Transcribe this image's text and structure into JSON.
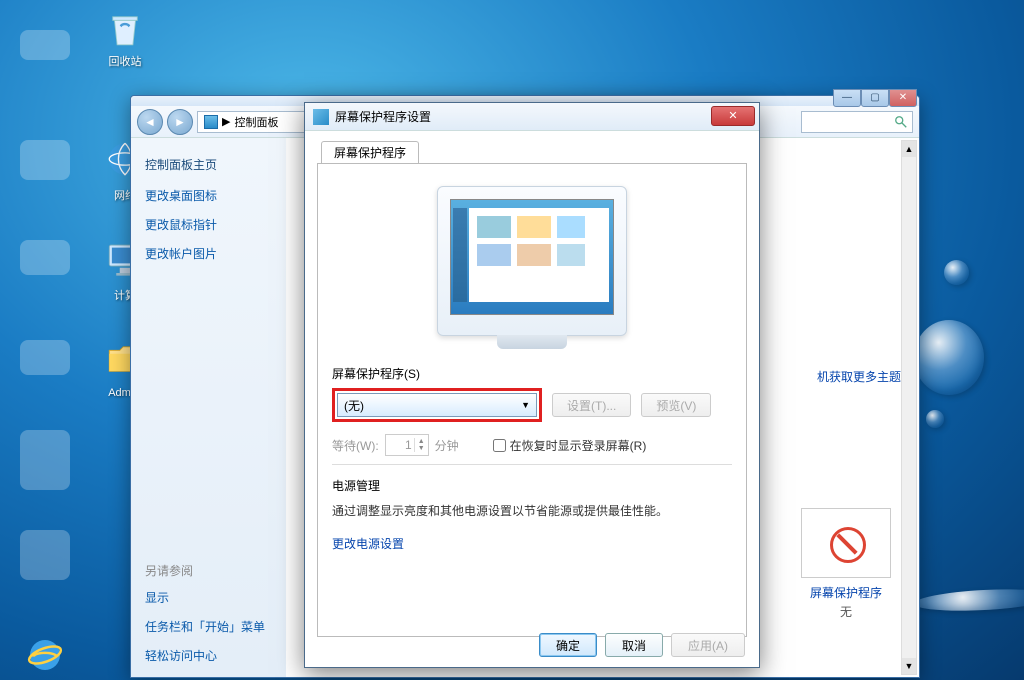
{
  "desktop": {
    "recycle": "回收站",
    "network": "网络",
    "computer": "计算",
    "admin": "Admini"
  },
  "cp": {
    "breadcrumb_sep": "▶",
    "breadcrumb": "控制面板",
    "sidebar": {
      "home": "控制面板主页",
      "link_desktop_icons": "更改桌面图标",
      "link_mouse": "更改鼠标指针",
      "link_account_pic": "更改帐户图片",
      "see_also": "另请参阅",
      "display": "显示",
      "taskbar": "任务栏和「开始」菜单",
      "ease": "轻松访问中心"
    },
    "right": {
      "more_themes": "机获取更多主题",
      "ss_link": "屏幕保护程序",
      "ss_state": "无"
    }
  },
  "ss": {
    "title": "屏幕保护程序设置",
    "tab": "屏幕保护程序",
    "label_select": "屏幕保护程序(S)",
    "selected": "(无)",
    "btn_settings": "设置(T)...",
    "btn_preview": "预览(V)",
    "wait_label": "等待(W):",
    "wait_value": "1",
    "wait_unit": "分钟",
    "resume_label": "在恢复时显示登录屏幕(R)",
    "pm_head": "电源管理",
    "pm_desc": "通过调整显示亮度和其他电源设置以节省能源或提供最佳性能。",
    "pm_link": "更改电源设置",
    "ok": "确定",
    "cancel": "取消",
    "apply": "应用(A)"
  }
}
